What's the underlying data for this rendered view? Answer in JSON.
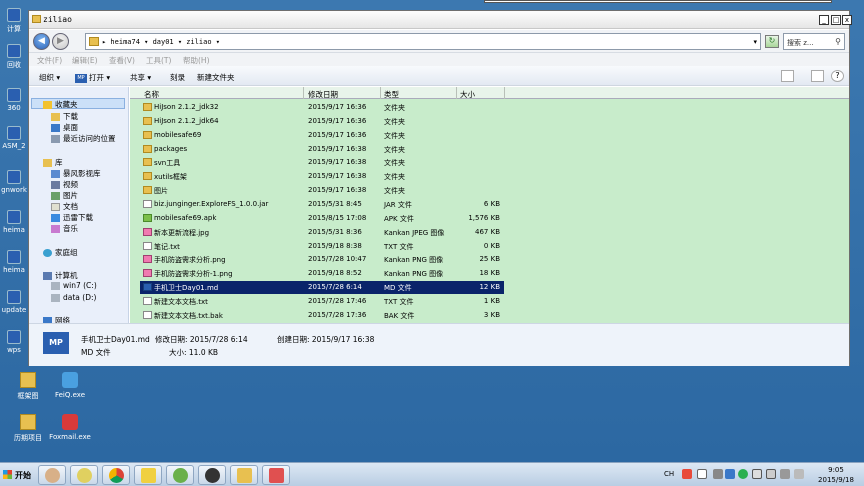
{
  "desktop": {
    "left_icons": [
      "计算",
      "回收",
      "360",
      "ASM_2",
      "gnwork",
      "heima",
      "heima",
      "update",
      "wps"
    ],
    "files": [
      {
        "label": "框架图",
        "icon": "folder-icon"
      },
      {
        "label": "FeiQ.exe",
        "icon": "feiq-icon"
      },
      {
        "label": "历期项目",
        "icon": "folder-icon"
      },
      {
        "label": "Foxmail.exe",
        "icon": "foxmail-icon"
      }
    ]
  },
  "window": {
    "title": "ziliao",
    "buttons": {
      "minimize": "_",
      "maximize": "□",
      "close": "x"
    },
    "address_path": "▸ heima74 ▾ day01 ▾ ziliao ▾",
    "search_placeholder": "搜索 z...",
    "menu": [
      "文件(F)",
      "编辑(E)",
      "查看(V)",
      "工具(T)",
      "帮助(H)"
    ],
    "toolbar": {
      "organize": "组织 ▾",
      "open": "打开 ▾",
      "share": "共享 ▾",
      "burn": "刻录",
      "new_folder": "新建文件夹"
    },
    "nav": {
      "favorites": "收藏夹",
      "fav_items": [
        "下载",
        "桌面",
        "最近访问的位置"
      ],
      "library": "库",
      "lib_items": [
        "暴风影视库",
        "视频",
        "图片",
        "文档",
        "迅雷下载",
        "音乐"
      ],
      "homegroup": "家庭组",
      "computer": "计算机",
      "drives": [
        "win7 (C:)",
        "data (D:)"
      ],
      "network": "网络"
    },
    "columns": [
      "名称",
      "修改日期",
      "类型",
      "大小"
    ],
    "files": [
      {
        "name": "HiJson 2.1.2_jdk32",
        "date": "2015/9/17 16:36",
        "type": "文件夹",
        "size": "",
        "icon": "folder-icon"
      },
      {
        "name": "HiJson 2.1.2_jdk64",
        "date": "2015/9/17 16:36",
        "type": "文件夹",
        "size": "",
        "icon": "folder-icon"
      },
      {
        "name": "mobilesafe69",
        "date": "2015/9/17 16:36",
        "type": "文件夹",
        "size": "",
        "icon": "folder-icon"
      },
      {
        "name": "packages",
        "date": "2015/9/17 16:38",
        "type": "文件夹",
        "size": "",
        "icon": "folder-icon"
      },
      {
        "name": "svn工具",
        "date": "2015/9/17 16:38",
        "type": "文件夹",
        "size": "",
        "icon": "folder-icon"
      },
      {
        "name": "xutils框架",
        "date": "2015/9/17 16:38",
        "type": "文件夹",
        "size": "",
        "icon": "folder-icon"
      },
      {
        "name": "图片",
        "date": "2015/9/17 16:38",
        "type": "文件夹",
        "size": "",
        "icon": "folder-icon"
      },
      {
        "name": "biz.junginger.ExploreFS_1.0.0.jar",
        "date": "2015/5/31 8:45",
        "type": "JAR 文件",
        "size": "6 KB",
        "icon": "file-icon"
      },
      {
        "name": "mobilesafe69.apk",
        "date": "2015/8/15 17:08",
        "type": "APK 文件",
        "size": "1,576 KB",
        "icon": "apk-icon"
      },
      {
        "name": "新本更新流程.jpg",
        "date": "2015/5/31 8:36",
        "type": "Kankan JPEG 图像",
        "size": "467 KB",
        "icon": "image-icon"
      },
      {
        "name": "笔记.txt",
        "date": "2015/9/18 8:38",
        "type": "TXT 文件",
        "size": "0 KB",
        "icon": "file-icon"
      },
      {
        "name": "手机防盗需求分析.png",
        "date": "2015/7/28 10:47",
        "type": "Kankan PNG 图像",
        "size": "25 KB",
        "icon": "image-icon"
      },
      {
        "name": "手机防盗需求分析-1.png",
        "date": "2015/9/18 8:52",
        "type": "Kankan PNG 图像",
        "size": "18 KB",
        "icon": "image-icon"
      },
      {
        "name": "手机卫士Day01.md",
        "date": "2015/7/28 6:14",
        "type": "MD 文件",
        "size": "12 KB",
        "icon": "md-icon",
        "selected": true
      },
      {
        "name": "新建文本文档.txt",
        "date": "2015/7/28 17:46",
        "type": "TXT 文件",
        "size": "1 KB",
        "icon": "file-icon"
      },
      {
        "name": "新建文本文档.txt.bak",
        "date": "2015/7/28 17:36",
        "type": "BAK 文件",
        "size": "3 KB",
        "icon": "file-icon"
      }
    ],
    "details": {
      "icon_text": "MP",
      "name": "手机卫士Day01.md",
      "modified": "修改日期: 2015/7/28 6:14",
      "created": "创建日期: 2015/9/17 16:38",
      "type": "MD 文件",
      "size": "大小: 11.0 KB"
    }
  },
  "taskbar": {
    "start": "开始",
    "apps": [
      "avatar-icon",
      "paint-icon",
      "chrome-icon",
      "folder-yellow-icon",
      "braces-icon",
      "shield-dark-icon",
      "explorer-icon",
      "eraser-icon"
    ],
    "tray_lang": "CH",
    "time": "9:05",
    "date": "2015/9/18"
  }
}
